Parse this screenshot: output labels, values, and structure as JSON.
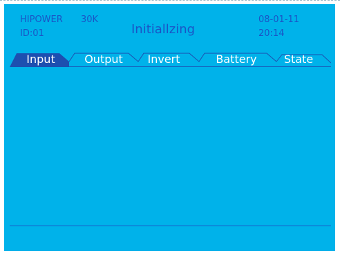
{
  "header": {
    "brand": "HIPOWER",
    "model": "30K",
    "device_id": "ID:01",
    "status": "Initiallzing",
    "date": "08-01-11",
    "time": "20:14"
  },
  "tabs": [
    {
      "label": "Input",
      "active": true
    },
    {
      "label": "Output",
      "active": false
    },
    {
      "label": "Invert",
      "active": false
    },
    {
      "label": "Battery",
      "active": false
    },
    {
      "label": "State",
      "active": false
    }
  ],
  "colors": {
    "screen_bg": "#00b2ea",
    "header_text": "#1a55c6",
    "active_tab": "#1d4fb0",
    "tab_text": "#ffffff"
  }
}
